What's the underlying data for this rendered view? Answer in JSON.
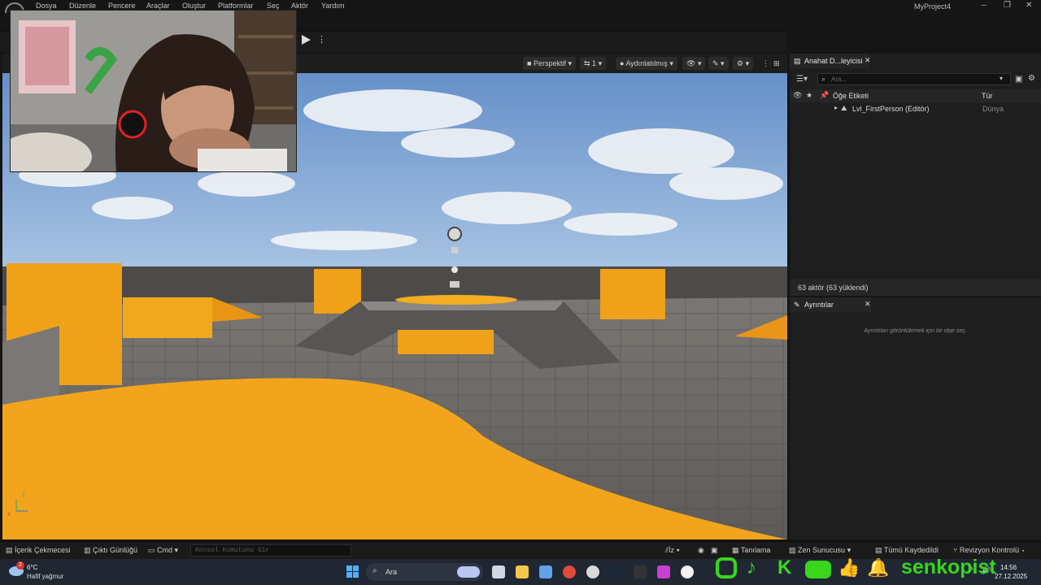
{
  "menu": {
    "items": [
      "Dosya",
      "Düzenle",
      "Pencere",
      "Araçlar",
      "Oluştur",
      "Platformlar",
      "Seç",
      "Aktör",
      "Yardım"
    ],
    "project_title": "MyProject4"
  },
  "viewport": {
    "perspective": "Perspektif",
    "camera_speed": "1",
    "lighting": "Aydınlatılmış",
    "axis": {
      "z": "z",
      "x": "x"
    }
  },
  "outliner": {
    "tab_title": "Anahat D...leyicisi",
    "search_placeholder": "Ara...",
    "col_label": "Öğe Etiketi",
    "col_type": "Tür",
    "rows": [
      {
        "label": "Lvl_FirstPerson (Editör)",
        "type": "Dünya"
      }
    ],
    "status": "63 aktör (63 yüklendi)"
  },
  "details": {
    "tab_title": "Ayrıntılar",
    "empty_msg": "Ayrıntıları görüntülemek için bir obje seç."
  },
  "bottom": {
    "content_drawer": "İçerik Çekmecesi",
    "output_log": "Çıktı Günlüğü",
    "cmd": "Cmd",
    "cmd_placeholder": "Konsol Komutunu Gir",
    "trace": "İz",
    "derivation": "Tanılama",
    "zen": "Zen Sunucusu",
    "save_all": "Tümü Kaydedildi",
    "revision": "Revizyon Kontrolü"
  },
  "taskbar": {
    "weather_temp": "6°C",
    "weather_desc": "Hafif yağmur",
    "weather_badge": "2",
    "search": "Ara",
    "time": "14:56",
    "date": "27.12.2025"
  },
  "overlay": {
    "channel": "senkopist",
    "color": "#39d61c"
  },
  "colors": {
    "accent_orange": "#f2a81c",
    "sky": "#6f9ad0",
    "floor": "#6e6b68"
  }
}
